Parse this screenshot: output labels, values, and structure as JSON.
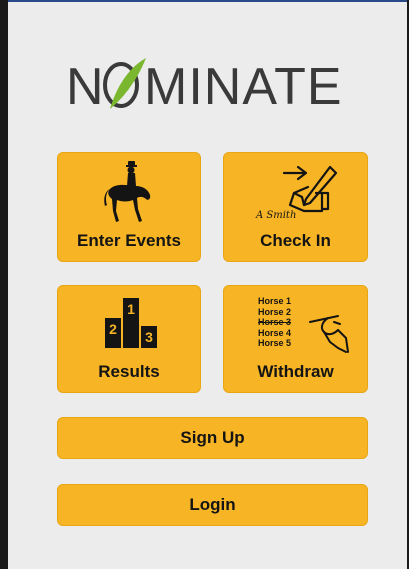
{
  "logo": {
    "text": "NOMINATE",
    "accent": "#7ab72e"
  },
  "tiles": [
    {
      "label": "Enter Events",
      "icon": "dressage-rider-icon"
    },
    {
      "label": "Check In",
      "icon": "signature-pen-icon",
      "signature": "A Smith"
    },
    {
      "label": "Results",
      "icon": "podium-icon",
      "podium": [
        "1",
        "2",
        "3"
      ]
    },
    {
      "label": "Withdraw",
      "icon": "horse-list-icon",
      "horses": [
        "Horse 1",
        "Horse 2",
        "Horse 3",
        "Horse 4",
        "Horse 5"
      ]
    }
  ],
  "buttons": {
    "signup": "Sign Up",
    "login": "Login"
  },
  "colors": {
    "tile": "#f7b425",
    "background": "#ececec",
    "text": "#141414"
  }
}
